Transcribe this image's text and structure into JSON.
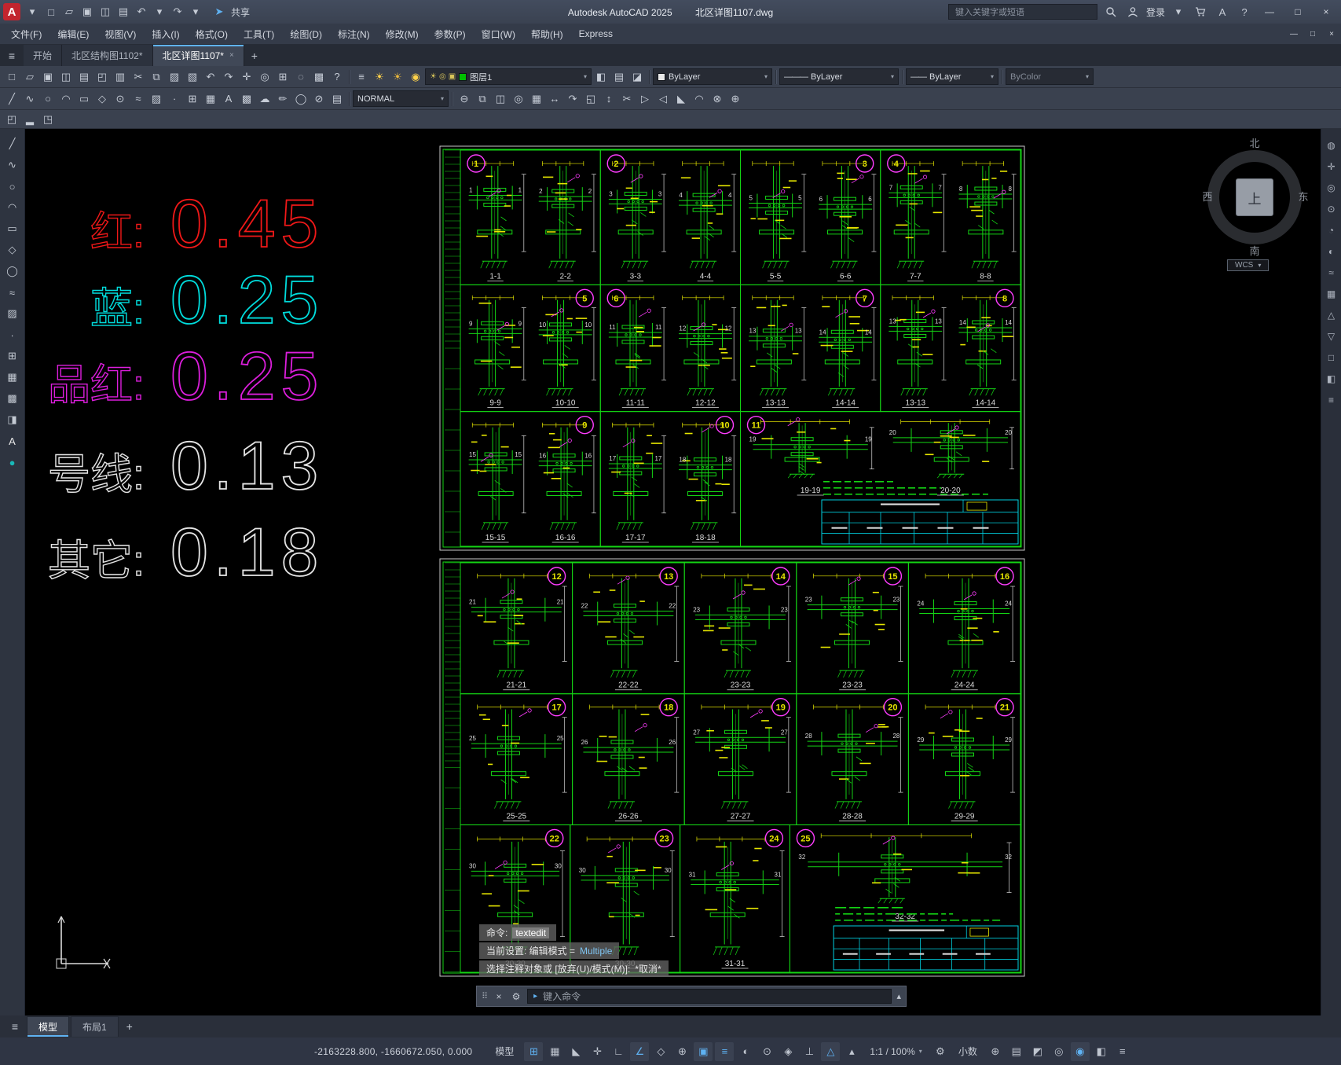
{
  "window": {
    "logo_letter": "A",
    "app_title": "Autodesk AutoCAD 2025",
    "doc_title": "北区详图1107.dwg",
    "share_label": "共享",
    "search_placeholder": "键入关键字或短语",
    "login_label": "登录"
  },
  "glyphs": {
    "caret_down": "▾",
    "caret_up": "▴",
    "close": "×",
    "minimize": "—",
    "maximize": "□",
    "hamburger": "≡",
    "plus": "+",
    "grip": "⠿",
    "wrench": "⚙",
    "prompt_arrow": "▸",
    "help": "?",
    "access": "A"
  },
  "titlebar_qat": [
    {
      "name": "qat-new",
      "glyph": "□"
    },
    {
      "name": "qat-open",
      "glyph": "▱"
    },
    {
      "name": "qat-save",
      "glyph": "▣"
    },
    {
      "name": "qat-save-as",
      "glyph": "◫"
    },
    {
      "name": "qat-plot",
      "glyph": "▤"
    },
    {
      "name": "qat-undo",
      "glyph": "↶"
    },
    {
      "name": "qat-undo-caret",
      "glyph": "▾"
    },
    {
      "name": "qat-redo",
      "glyph": "↷"
    },
    {
      "name": "qat-redo-caret",
      "glyph": "▾"
    }
  ],
  "menubar": {
    "items": [
      "文件(F)",
      "编辑(E)",
      "视图(V)",
      "插入(I)",
      "格式(O)",
      "工具(T)",
      "绘图(D)",
      "标注(N)",
      "修改(M)",
      "参数(P)",
      "窗口(W)",
      "帮助(H)",
      "Express"
    ]
  },
  "doc_tabs": {
    "items": [
      {
        "label": "开始",
        "active": false,
        "closable": false
      },
      {
        "label": "北区结构图1102*",
        "active": false,
        "closable": false
      },
      {
        "label": "北区详图1107*",
        "active": true,
        "closable": true
      }
    ]
  },
  "toolbar_row1": {
    "file_icons": [
      {
        "name": "new",
        "glyph": "□"
      },
      {
        "name": "open",
        "glyph": "▱"
      },
      {
        "name": "save",
        "glyph": "▣"
      },
      {
        "name": "save-all",
        "glyph": "◫"
      },
      {
        "name": "plot",
        "glyph": "▤"
      },
      {
        "name": "plot-preview",
        "glyph": "◰"
      },
      {
        "name": "publish",
        "glyph": "▥"
      },
      {
        "name": "cut",
        "glyph": "✂"
      },
      {
        "name": "copy",
        "glyph": "⧉"
      },
      {
        "name": "paste",
        "glyph": "▨"
      },
      {
        "name": "match-properties",
        "glyph": "▧"
      },
      {
        "name": "undo",
        "glyph": "↶"
      },
      {
        "name": "redo",
        "glyph": "↷"
      },
      {
        "name": "pan",
        "glyph": "✛"
      },
      {
        "name": "zoom-realtime",
        "glyph": "◎"
      },
      {
        "name": "zoom-window",
        "glyph": "⊞"
      },
      {
        "name": "zoom-previous",
        "glyph": "◌"
      },
      {
        "name": "properties",
        "glyph": "▩"
      },
      {
        "name": "help",
        "glyph": "?"
      }
    ],
    "layer_icons": [
      {
        "name": "layer-properties",
        "glyph": "≡",
        "color": "#c6ccd6"
      },
      {
        "name": "layer-on",
        "glyph": "☀",
        "color": "#ffd24a"
      },
      {
        "name": "layer-freeze",
        "glyph": "☀",
        "color": "#e8b63c"
      },
      {
        "name": "layer-lock",
        "glyph": "◉",
        "color": "#ffd24a"
      }
    ],
    "layer_dropdown": {
      "value": "图层1",
      "swatch": "#00bf00",
      "state_glyphs": [
        "☀",
        "◎",
        "▣"
      ]
    },
    "layer_tool_icons": [
      {
        "name": "layer-previous",
        "glyph": "◧"
      },
      {
        "name": "layer-states",
        "glyph": "▤"
      },
      {
        "name": "layer-isolate",
        "glyph": "◪"
      }
    ],
    "color_dropdown": {
      "value": "ByLayer",
      "swatch": "#e8e8e8"
    },
    "linetype_dropdown": {
      "value": "ByLayer",
      "sample": "———"
    },
    "lineweight_dropdown": {
      "value": "ByLayer",
      "sample": "——"
    },
    "plotstyle_dropdown": {
      "value": "ByColor"
    }
  },
  "toolbar_row2": {
    "style_dropdown": {
      "value": "NORMAL"
    },
    "left_icons": [
      {
        "name": "draw-line",
        "glyph": "╱"
      },
      {
        "name": "draw-polyline",
        "glyph": "∿"
      },
      {
        "name": "draw-circle",
        "glyph": "○"
      },
      {
        "name": "draw-arc",
        "glyph": "◠"
      },
      {
        "name": "draw-rectangle",
        "glyph": "▭"
      },
      {
        "name": "draw-polygon",
        "glyph": "◇"
      },
      {
        "name": "draw-donut",
        "glyph": "⊙"
      },
      {
        "name": "draw-spline",
        "glyph": "≈"
      },
      {
        "name": "draw-hatch",
        "glyph": "▨"
      },
      {
        "name": "draw-point",
        "glyph": "∙"
      },
      {
        "name": "insert-block",
        "glyph": "⊞"
      },
      {
        "name": "draw-table",
        "glyph": "▦"
      },
      {
        "name": "draw-text",
        "glyph": "A"
      },
      {
        "name": "draw-region",
        "glyph": "▩"
      },
      {
        "name": "draw-revcloud",
        "glyph": "☁"
      },
      {
        "name": "edit-pencil",
        "glyph": "✏"
      },
      {
        "name": "draw-ellipse",
        "glyph": "◯"
      },
      {
        "name": "draw-xline",
        "glyph": "⊘"
      },
      {
        "name": "draw-mline",
        "glyph": "▤"
      }
    ],
    "right_icons": [
      {
        "name": "erase",
        "glyph": "⊖"
      },
      {
        "name": "copy-object",
        "glyph": "⧉"
      },
      {
        "name": "mirror",
        "glyph": "◫"
      },
      {
        "name": "offset",
        "glyph": "◎"
      },
      {
        "name": "array",
        "glyph": "▦"
      },
      {
        "name": "move",
        "glyph": "↔"
      },
      {
        "name": "rotate",
        "glyph": "↷"
      },
      {
        "name": "scale",
        "glyph": "◱"
      },
      {
        "name": "stretch",
        "glyph": "↕"
      },
      {
        "name": "trim",
        "glyph": "✂"
      },
      {
        "name": "extend",
        "glyph": "▷"
      },
      {
        "name": "break",
        "glyph": "◁"
      },
      {
        "name": "chamfer",
        "glyph": "◣"
      },
      {
        "name": "fillet",
        "glyph": "◠"
      },
      {
        "name": "explode",
        "glyph": "⊗"
      },
      {
        "name": "join",
        "glyph": "⊕"
      }
    ]
  },
  "toolbar_row3": {
    "icons": [
      {
        "name": "workspace-switch",
        "glyph": "◰"
      },
      {
        "name": "annotation-tool",
        "glyph": "▂"
      },
      {
        "name": "palette-tool",
        "glyph": "◳"
      }
    ]
  },
  "palette_icons": [
    {
      "name": "line",
      "glyph": "╱"
    },
    {
      "name": "polyline",
      "glyph": "∿"
    },
    {
      "name": "circle",
      "glyph": "○"
    },
    {
      "name": "arc",
      "glyph": "◠"
    },
    {
      "name": "rectangle",
      "glyph": "▭"
    },
    {
      "name": "polygon",
      "glyph": "◇"
    },
    {
      "name": "ellipse",
      "glyph": "◯"
    },
    {
      "name": "spline",
      "glyph": "≈"
    },
    {
      "name": "hatch",
      "glyph": "▨"
    },
    {
      "name": "point",
      "glyph": "∙"
    },
    {
      "name": "block",
      "glyph": "⊞"
    },
    {
      "name": "table",
      "glyph": "▦"
    },
    {
      "name": "region",
      "glyph": "▩"
    },
    {
      "name": "gradient",
      "glyph": "◨"
    },
    {
      "name": "text",
      "glyph": "A",
      "color": "#e8e8e8"
    },
    {
      "name": "color-dot",
      "glyph": "●",
      "color": "#19b8b8"
    }
  ],
  "navbar_icons": [
    {
      "name": "full-navigation-wheel",
      "glyph": "◍"
    },
    {
      "name": "pan-tool",
      "glyph": "✛"
    },
    {
      "name": "zoom-tool",
      "glyph": "◎"
    },
    {
      "name": "orbit-tool",
      "glyph": "⊙"
    },
    {
      "name": "showmotion-tool",
      "glyph": "◔"
    },
    {
      "name": "steering-tool",
      "glyph": "◐"
    },
    {
      "name": "nav-spline",
      "glyph": "≈"
    },
    {
      "name": "nav-grid",
      "glyph": "▦"
    },
    {
      "name": "nav-up",
      "glyph": "△"
    },
    {
      "name": "nav-down",
      "glyph": "▽"
    },
    {
      "name": "nav-box",
      "glyph": "□"
    },
    {
      "name": "nav-half",
      "glyph": "◧"
    },
    {
      "name": "nav-menu",
      "glyph": "≡"
    }
  ],
  "legend": [
    {
      "label": "红:",
      "value": "0.45",
      "color": "#f01818"
    },
    {
      "label": "蓝:",
      "value": "0.25",
      "color": "#00dcdc"
    },
    {
      "label": "品红:",
      "value": "0.25",
      "color": "#dc1edc"
    },
    {
      "label": "号线:",
      "value": "0.13",
      "color": "#e4e4e4"
    },
    {
      "label": "其它:",
      "value": "0.18",
      "color": "#e4e4e4"
    }
  ],
  "viewcube": {
    "north": "北",
    "south": "南",
    "west": "西",
    "east": "东",
    "top": "上",
    "wcs_label": "WCS"
  },
  "sheets": [
    {
      "rows": [
        {
          "cells": [
            {
              "num": "1",
              "labels": [
                "1-1",
                "2-2"
              ],
              "badge": "tl"
            },
            {
              "num": "2",
              "labels": [
                "3-3",
                "4-4"
              ],
              "badge": "tl"
            },
            {
              "num": "3",
              "labels": [
                "5-5",
                "6-6"
              ],
              "badge": "tr"
            },
            {
              "num": "4",
              "labels": [
                "7-7",
                "8-8"
              ],
              "badge": "tl"
            }
          ]
        },
        {
          "cells": [
            {
              "num": "5",
              "labels": [
                "9-9",
                "10-10"
              ],
              "badge": "tr"
            },
            {
              "num": "6",
              "labels": [
                "11-11",
                "12-12"
              ],
              "badge": "tl"
            },
            {
              "num": "7",
              "labels": [
                "13-13",
                "14-14"
              ],
              "badge": "tr"
            },
            {
              "num": "8",
              "labels": [
                "13-13",
                "14-14"
              ],
              "badge": "tr"
            }
          ]
        },
        {
          "cells": [
            {
              "num": "9",
              "labels": [
                "15-15",
                "16-16"
              ],
              "badge": "tr"
            },
            {
              "num": "10",
              "labels": [
                "17-17",
                "18-18"
              ],
              "badge": "tr"
            },
            {
              "num": "11",
              "labels": [
                "19-19",
                "20-20"
              ],
              "badge": "tl",
              "titleblock": true
            }
          ]
        }
      ]
    },
    {
      "rows": [
        {
          "cells": [
            {
              "num": "12",
              "labels": [
                "21-21"
              ],
              "badge": "tr"
            },
            {
              "num": "13",
              "labels": [
                "22-22"
              ],
              "badge": "tr"
            },
            {
              "num": "14",
              "labels": [
                "23-23"
              ],
              "badge": "tr"
            },
            {
              "num": "15",
              "labels": [
                "23-23"
              ],
              "badge": "tr"
            },
            {
              "num": "16",
              "labels": [
                "24-24"
              ],
              "badge": "tr"
            }
          ]
        },
        {
          "cells": [
            {
              "num": "17",
              "labels": [
                "25-25"
              ],
              "badge": "tr"
            },
            {
              "num": "18",
              "labels": [
                "26-26"
              ],
              "badge": "tr"
            },
            {
              "num": "19",
              "labels": [
                "27-27"
              ],
              "badge": "tr"
            },
            {
              "num": "20",
              "labels": [
                "28-28"
              ],
              "badge": "tr"
            },
            {
              "num": "21",
              "labels": [
                "29-29"
              ],
              "badge": "tr"
            }
          ]
        },
        {
          "cells": [
            {
              "num": "22",
              "labels": [
                "30-30"
              ],
              "badge": "tr"
            },
            {
              "num": "23",
              "labels": [
                "30-30"
              ],
              "badge": "tr"
            },
            {
              "num": "24",
              "labels": [
                "31-31"
              ],
              "badge": "tr"
            },
            {
              "num": "25",
              "labels": [
                "32-32"
              ],
              "badge": "tl",
              "titleblock": true
            }
          ]
        }
      ]
    }
  ],
  "command": {
    "history": [
      {
        "prefix": "命令:",
        "value": "textedit",
        "style": "chip"
      },
      {
        "prefix": "当前设置: 编辑模式 =",
        "value": "Multiple",
        "style": "link"
      },
      {
        "prefix": "选择注释对象或 [放弃(U)/模式(M)]:",
        "value": "*取消*",
        "style": "plain"
      }
    ],
    "prompt_placeholder": "键入命令"
  },
  "layout_tabs": {
    "items": [
      {
        "label": "模型",
        "active": true
      },
      {
        "label": "布局1",
        "active": false
      }
    ]
  },
  "statusbar": {
    "coords": "-2163228.800, -1660672.050, 0.000",
    "model_label": "模型",
    "icons_main": [
      {
        "name": "grid-display",
        "glyph": "⊞",
        "active": true
      },
      {
        "name": "snap-mode",
        "glyph": "▦",
        "active": false
      },
      {
        "name": "infer-constraints",
        "glyph": "◣",
        "active": false
      },
      {
        "name": "dynamic-input",
        "glyph": "✛",
        "active": false
      },
      {
        "name": "ortho-mode",
        "glyph": "∟",
        "active": false
      },
      {
        "name": "polar-tracking",
        "glyph": "∠",
        "active": true
      },
      {
        "name": "isometric-drafting",
        "glyph": "◇",
        "active": false
      },
      {
        "name": "object-snap-tracking",
        "glyph": "⊕",
        "active": false
      },
      {
        "name": "object-snap",
        "glyph": "▣",
        "active": true
      },
      {
        "name": "lineweight-display",
        "glyph": "≡",
        "active": true
      },
      {
        "name": "transparency",
        "glyph": "◐",
        "active": false
      },
      {
        "name": "selection-cycling",
        "glyph": "⊙",
        "active": false
      },
      {
        "name": "3d-object-snap",
        "glyph": "◈",
        "active": false
      },
      {
        "name": "dynamic-ucs",
        "glyph": "⊥",
        "active": false
      },
      {
        "name": "annotation-visibility",
        "glyph": "△",
        "active": true
      },
      {
        "name": "autoscale",
        "glyph": "▴",
        "active": false
      }
    ],
    "scale_label": "1:1 / 100%",
    "units_label": "小数",
    "icons_right": [
      {
        "name": "annotation-monitor",
        "glyph": "⊕",
        "active": false
      },
      {
        "name": "quick-properties",
        "glyph": "▤",
        "active": false
      },
      {
        "name": "lock-ui",
        "glyph": "◩",
        "active": false
      },
      {
        "name": "isolate-objects",
        "glyph": "◎",
        "active": false
      },
      {
        "name": "graphics-performance",
        "glyph": "◉",
        "active": true
      },
      {
        "name": "clean-screen",
        "glyph": "◧",
        "active": false
      },
      {
        "name": "customization",
        "glyph": "≡",
        "active": false
      }
    ]
  },
  "cad_colors": {
    "green": "#14d414",
    "yellow": "#e6e600",
    "white": "#dcdcdc",
    "magenta": "#ff3dff",
    "cyan": "#00d0e0",
    "border": "#c8c8c8"
  }
}
